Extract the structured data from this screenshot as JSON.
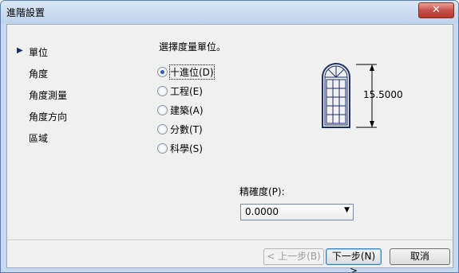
{
  "window": {
    "title": "進階設置",
    "close_icon": "close-icon"
  },
  "sidebar": {
    "items": [
      {
        "label": "單位",
        "selected": true
      },
      {
        "label": "角度",
        "selected": false
      },
      {
        "label": "角度測量",
        "selected": false
      },
      {
        "label": "角度方向",
        "selected": false
      },
      {
        "label": "區域",
        "selected": false
      }
    ]
  },
  "main": {
    "prompt": "選擇度量單位。",
    "units": [
      {
        "label": "十進位(D)",
        "checked": true
      },
      {
        "label": "工程(E)",
        "checked": false
      },
      {
        "label": "建築(A)",
        "checked": false
      },
      {
        "label": "分數(T)",
        "checked": false
      },
      {
        "label": "科學(S)",
        "checked": false
      }
    ],
    "preview_dimension": "15.5000",
    "precision_label": "精確度(P):",
    "precision_value": "0.0000"
  },
  "buttons": {
    "back": "< 上一步(B)",
    "next": "下一步(N) >",
    "cancel": "取消"
  },
  "colors": {
    "accent": "#1c2f6b",
    "window_frame": "#c6d9f0",
    "close": "#c75050"
  }
}
